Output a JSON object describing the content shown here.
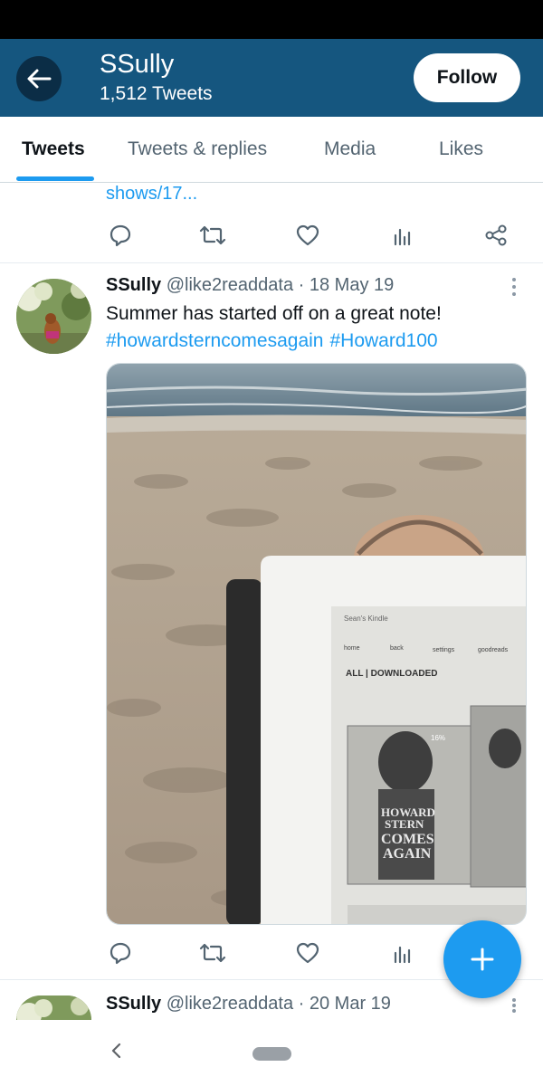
{
  "header": {
    "name": "SSully",
    "tweet_count": "1,512 Tweets",
    "follow_label": "Follow"
  },
  "tabs": [
    {
      "label": "Tweets",
      "active": true
    },
    {
      "label": "Tweets & replies",
      "active": false
    },
    {
      "label": "Media",
      "active": false
    },
    {
      "label": "Likes",
      "active": false
    }
  ],
  "previous_tweet": {
    "link_fragment": "shows/17..."
  },
  "tweets": [
    {
      "name": "SSully",
      "handle": "@like2readdata",
      "date": "· 18 May 19",
      "text": "Summer has started off on a great note!",
      "hashtags": [
        "#howardsterncomesagain",
        "#Howard100"
      ],
      "image": {
        "kindle_header": "Sean's Kindle",
        "nav_labels": [
          "home",
          "back",
          "settings",
          "goodreads"
        ],
        "library_filter": "ALL | DOWNLOADED",
        "progress_badge": "16%",
        "book_title_lines": [
          "HOWARD",
          "STERN",
          "COMES",
          "AGAIN"
        ]
      }
    },
    {
      "name": "SSully",
      "handle": "@like2readdata",
      "date": "· 20 Mar 19"
    }
  ],
  "icons": {
    "back": "arrow-left-icon",
    "reply": "reply-icon",
    "retweet": "retweet-icon",
    "like": "heart-icon",
    "analytics": "analytics-icon",
    "share": "share-icon",
    "more": "more-vertical-icon",
    "compose": "plus-icon"
  },
  "colors": {
    "header_bg": "#15567f",
    "accent": "#1d9bf0",
    "text_primary": "#0f1419",
    "text_secondary": "#536471"
  }
}
